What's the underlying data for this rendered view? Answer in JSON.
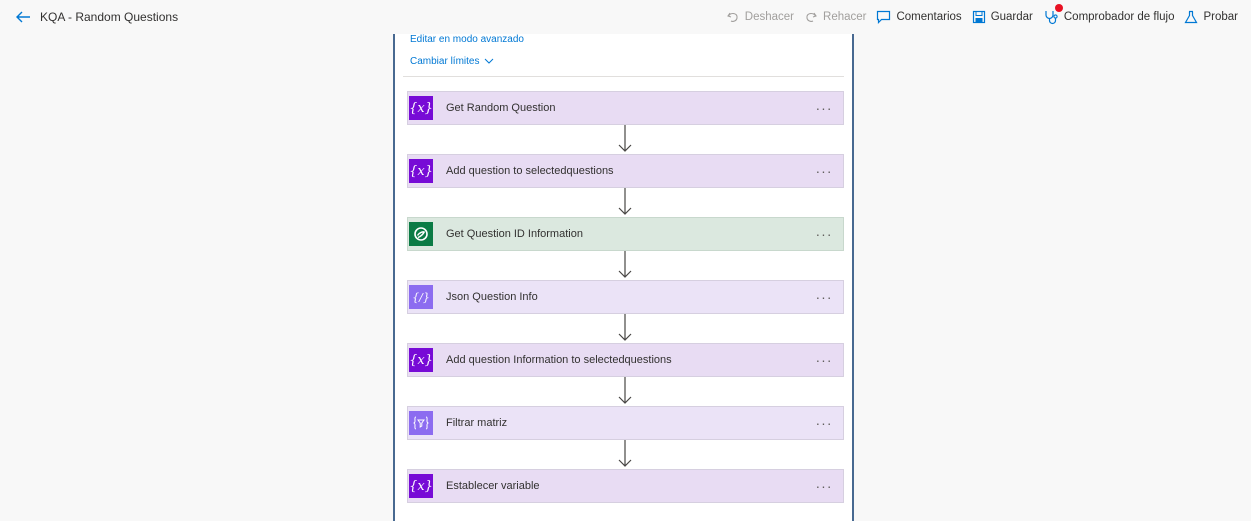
{
  "header": {
    "title": "KQA - Random Questions",
    "undo_label": "Deshacer",
    "redo_label": "Rehacer",
    "comments_label": "Comentarios",
    "save_label": "Guardar",
    "checker_label": "Comprobador de flujo",
    "test_label": "Probar"
  },
  "scope": {
    "advanced_link": "Editar en modo avanzado",
    "limits_link": "Cambiar límites"
  },
  "steps": [
    {
      "label": "Get Random Question",
      "kind": "variable",
      "icon": "variable-icon"
    },
    {
      "label": "Add question to selectedquestions",
      "kind": "variable",
      "icon": "variable-icon"
    },
    {
      "label": "Get Question ID Information",
      "kind": "dataverse",
      "icon": "dataverse-icon"
    },
    {
      "label": "Json Question Info",
      "kind": "data-operation",
      "icon": "json-icon"
    },
    {
      "label": "Add question Information to selectedquestions",
      "kind": "variable",
      "icon": "variable-icon"
    },
    {
      "label": "Filtrar matriz",
      "kind": "data-operation",
      "icon": "filter-icon"
    },
    {
      "label": "Establecer variable",
      "kind": "variable",
      "icon": "variable-icon"
    }
  ],
  "more_glyph": "···",
  "colors": {
    "variable_icon": "#770bd6",
    "variable_bg": "#e8dcf3",
    "dataverse_icon": "#0b7b45",
    "dataverse_bg": "#dbe8df",
    "data_operation_icon": "#8c6cf0",
    "data_operation_bg": "#ebe3f7",
    "link": "#0078d4",
    "alert_dot": "#e81123"
  }
}
